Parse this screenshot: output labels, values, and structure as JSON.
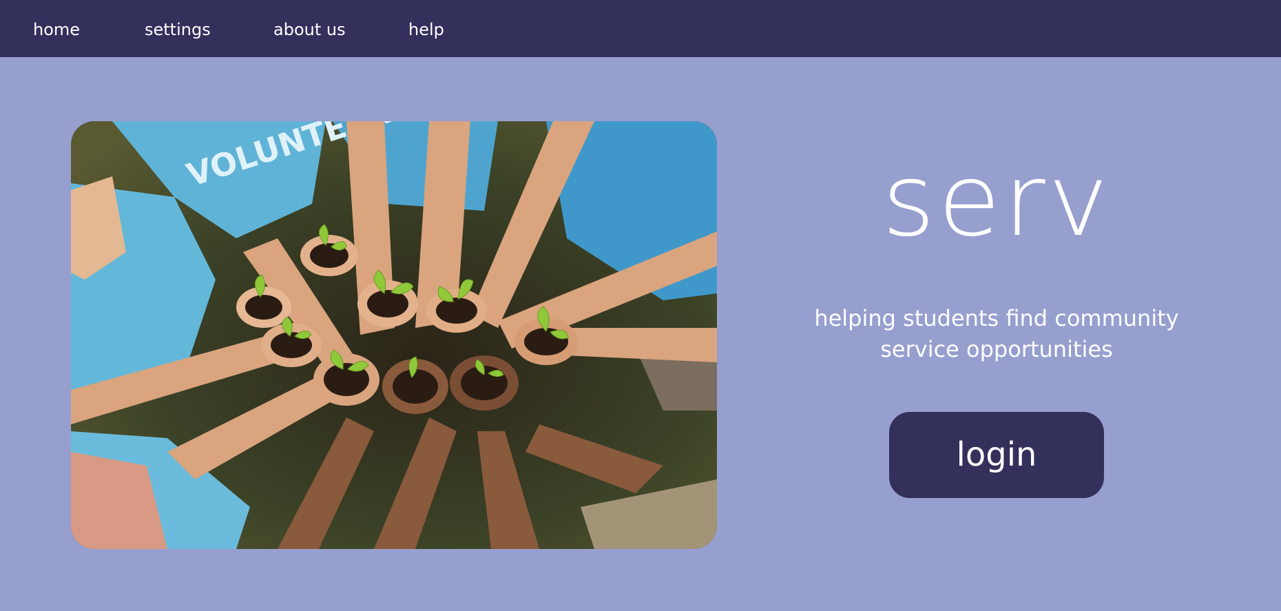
{
  "nav": {
    "items": [
      {
        "label": "home"
      },
      {
        "label": "settings"
      },
      {
        "label": "about us"
      },
      {
        "label": "help"
      }
    ]
  },
  "hero": {
    "image_alt": "volunteers holding seedlings in soil",
    "shirt_text": "VOLUNTEER"
  },
  "brand": {
    "title": "serv",
    "tagline": "helping students find community service opportunities"
  },
  "actions": {
    "login_label": "login"
  },
  "colors": {
    "navbar": "#34305c",
    "background": "#979fcf",
    "button": "#34305c",
    "text": "#ffffff"
  }
}
